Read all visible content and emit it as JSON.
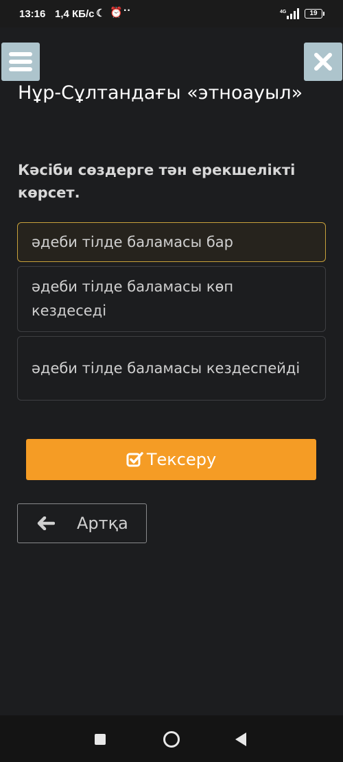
{
  "status_bar": {
    "time": "13:16",
    "speed": "1,4 КБ/с",
    "network": "4G",
    "battery": "19"
  },
  "header": {
    "menu_icon": "hamburger-icon",
    "close_icon": "close-icon"
  },
  "lesson": {
    "title": "Нұр-Сұлтандағы «этноауыл»",
    "question": "Кәсіби сөздерге тән ерекшелікті көрсет."
  },
  "options": [
    {
      "label": "әдеби тілде баламасы бар",
      "selected": true
    },
    {
      "label": "әдеби тілде баламасы көп кездеседі",
      "selected": false
    },
    {
      "label": "әдеби тілде баламасы кездеспейді",
      "selected": false
    }
  ],
  "actions": {
    "check_label": "Тексеру",
    "back_label": "Артқа"
  },
  "colors": {
    "background": "#1c1d1f",
    "accent": "#f59c25",
    "selected_border": "#c9a23b",
    "header_button": "#adc4cc"
  }
}
